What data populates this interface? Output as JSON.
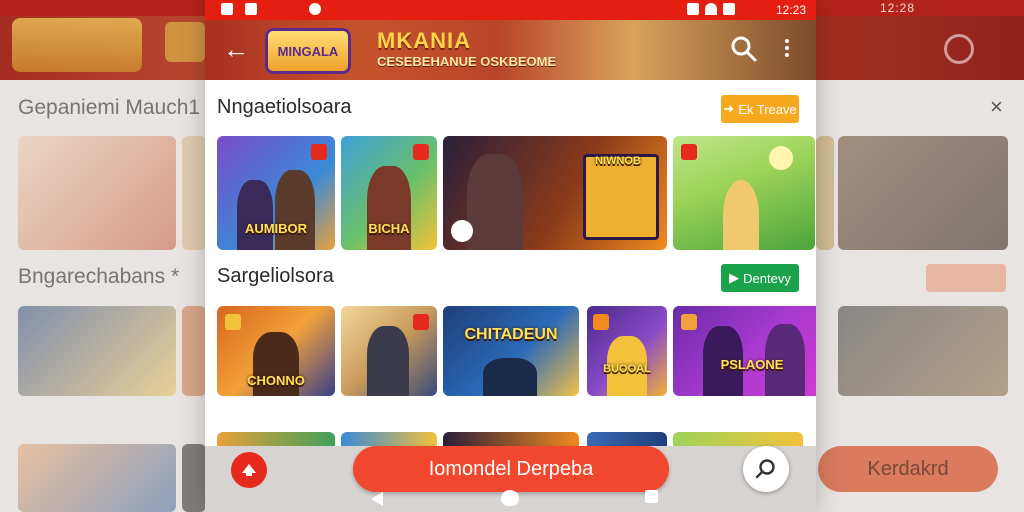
{
  "background": {
    "section_title_1": "Gepaniemi Mauch1",
    "section_title_2": "Bngarechabans *",
    "cta_label": "Kerdakrd",
    "close_glyph": "×",
    "status_text": "12:28"
  },
  "statusbar": {
    "time": "12:23"
  },
  "appbar": {
    "back_glyph": "←",
    "logo_text": "MINGALA",
    "brand_title": "MKANIA",
    "brand_subtitle": "CESEBEHANUE OSKBEOME"
  },
  "sections": [
    {
      "title": "Nngaetiolsoara",
      "button_label": "Ek Treave",
      "button_icon": "arrow-icon",
      "cards": [
        {
          "label": "AUMIBOR",
          "colors": [
            "#7a4cc6",
            "#e8a13a"
          ]
        },
        {
          "label": "BICHA",
          "colors": [
            "#3fa0d8",
            "#f2c23a"
          ]
        },
        {
          "label": "NIWNOB",
          "colors": [
            "#2a1f3a",
            "#f08a1e"
          ]
        },
        {
          "label": "",
          "colors": [
            "#9ed35a",
            "#4aa53a"
          ]
        }
      ]
    },
    {
      "title": "Sargeliolsora",
      "button_label": "Dentevy",
      "button_icon": "play-icon",
      "cards": [
        {
          "label": "CHONNO",
          "colors": [
            "#d8651f",
            "#3a3f8a"
          ]
        },
        {
          "label": "",
          "colors": [
            "#f2d79a",
            "#3a4a7a"
          ]
        },
        {
          "label": "CHITADEUN",
          "colors": [
            "#1f3f7a",
            "#f0c04a"
          ]
        },
        {
          "label": "BUOOAL",
          "colors": [
            "#4a2a8a",
            "#f2b03a"
          ]
        },
        {
          "label": "PSLAONE",
          "colors": [
            "#6a2aa8",
            "#d83ad0"
          ]
        }
      ]
    }
  ],
  "bottom": {
    "cta_label": "Iomondel Derpeba",
    "left_fab_icon": "up-arrow-icon",
    "right_fab_icon": "search-icon"
  },
  "colors": {
    "statusbar": "#e41f12",
    "cta": "#f1472f",
    "accent_orange": "#f7a81f",
    "accent_green": "#1aa34a"
  }
}
